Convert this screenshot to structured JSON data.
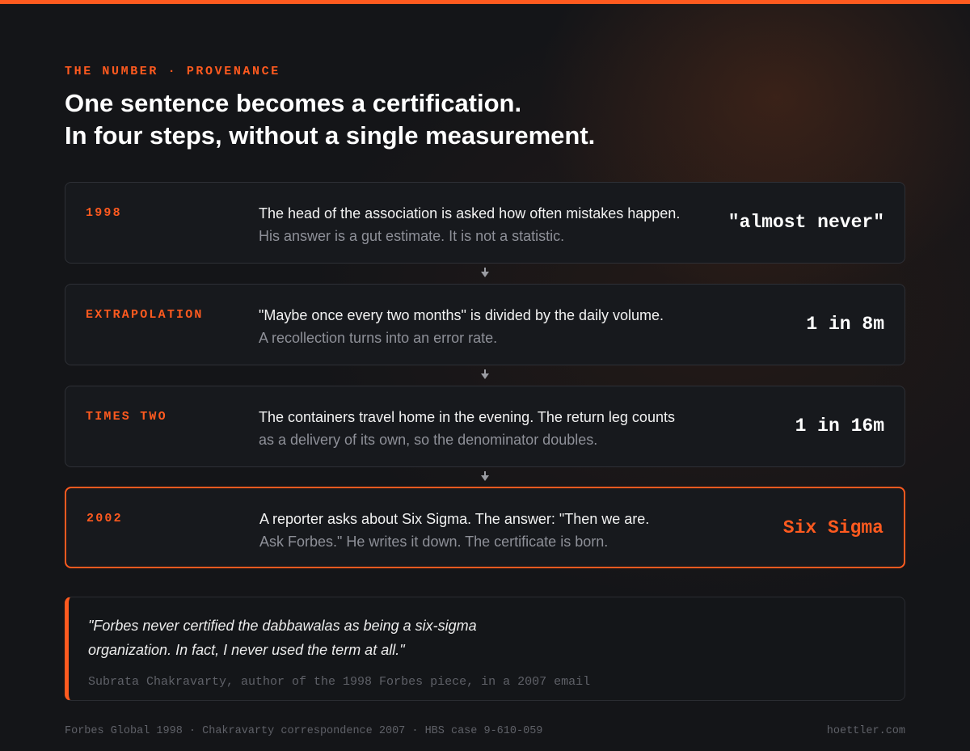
{
  "header": {
    "eyebrow": "THE NUMBER · PROVENANCE",
    "headline_line1": "One sentence becomes a certification.",
    "headline_line2": "In four steps, without a single measurement."
  },
  "steps": [
    {
      "label": "1998",
      "main": "The head of the association is asked how often mistakes happen.",
      "sub": "His answer is a gut estimate. It is not a statistic.",
      "value": "\"almost never\""
    },
    {
      "label": "EXTRAPOLATION",
      "main": "\"Maybe once every two months\" is divided by the daily volume.",
      "sub": "A recollection turns into an error rate.",
      "value": "1 in 8m"
    },
    {
      "label": "TIMES TWO",
      "main": "The containers travel home in the evening. The return leg counts",
      "sub": "as a delivery of its own, so the denominator doubles.",
      "value": "1 in 16m"
    },
    {
      "label": "2002",
      "main": "A reporter asks about Six Sigma. The answer: \"Then we are.",
      "sub": "Ask Forbes.\" He writes it down. The certificate is born.",
      "value": "Six Sigma",
      "highlighted": true
    }
  ],
  "quote": {
    "line1": "\"Forbes never certified the dabbawalas as being a six-sigma",
    "line2": "organization. In fact, I never used the term at all.\"",
    "attribution": "Subrata Chakravarty, author of the 1998 Forbes piece, in a 2007 email"
  },
  "footer": {
    "sources": "Forbes Global 1998 · Chakravarty correspondence 2007 · HBS case 9-610-059",
    "site": "hoettler.com"
  },
  "colors": {
    "accent": "#ff5a1f",
    "background": "#141518",
    "card": "#17191d",
    "muted_text": "#8e9098"
  },
  "icons": [
    "arrow-down-icon"
  ]
}
